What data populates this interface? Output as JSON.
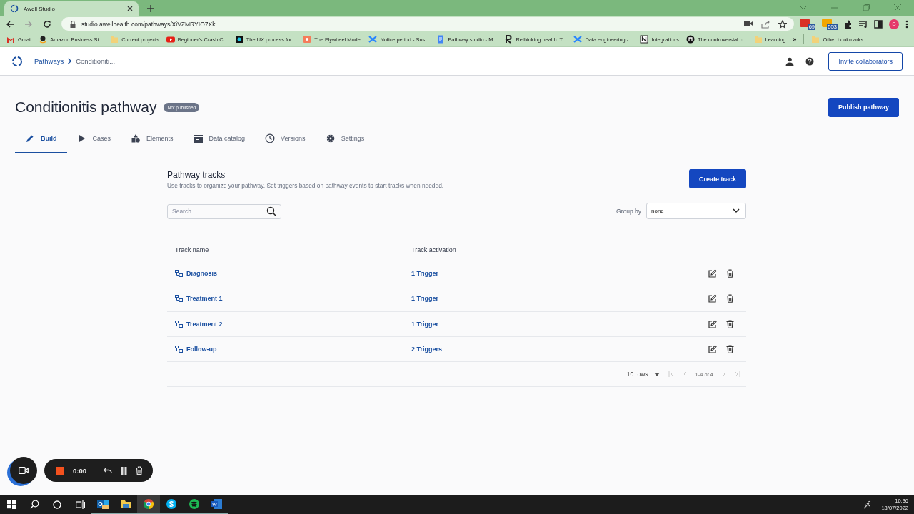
{
  "browser": {
    "tab_title": "Awell Studio",
    "url": "studio.awellhealth.com/pathways/XiVZMRYIO7Xk",
    "extensions": [
      {
        "badge": "69",
        "color": "#d93025"
      },
      {
        "badge": "553",
        "color": "#f2a600"
      }
    ],
    "profile_initial": "S",
    "bookmarks": [
      {
        "label": "Gmail",
        "kind": "gmail"
      },
      {
        "label": "Amazon Business Si...",
        "kind": "amazon"
      },
      {
        "label": "Current projects",
        "kind": "folder"
      },
      {
        "label": "Beginner's Crash C...",
        "kind": "youtube"
      },
      {
        "label": "The UX process for...",
        "kind": "dark"
      },
      {
        "label": "The Flywheel Model",
        "kind": "hubspot"
      },
      {
        "label": "Notice period - Sus...",
        "kind": "confluence"
      },
      {
        "label": "Pathway studio - M...",
        "kind": "docs"
      },
      {
        "label": "Rethinking health: T...",
        "kind": "r"
      },
      {
        "label": "Data engineering -...",
        "kind": "confluence"
      },
      {
        "label": "Integrations",
        "kind": "notion"
      },
      {
        "label": "The controversial c...",
        "kind": "circle"
      },
      {
        "label": "Learning",
        "kind": "folder"
      }
    ],
    "more": "»",
    "other_bookmarks": "Other bookmarks"
  },
  "app": {
    "breadcrumb": [
      {
        "label": "Pathways",
        "link": true
      },
      {
        "label": "Conditioniti...",
        "link": false
      }
    ],
    "invite_button": "Invite collaborators",
    "title": "Conditionitis pathway",
    "status_badge": "Not published",
    "publish_button": "Publish pathway",
    "tabs": [
      {
        "label": "Build",
        "kind": "pencil",
        "selected": true
      },
      {
        "label": "Cases",
        "kind": "play",
        "selected": false
      },
      {
        "label": "Elements",
        "kind": "shapes",
        "selected": false
      },
      {
        "label": "Data catalog",
        "kind": "catalog",
        "selected": false
      },
      {
        "label": "Versions",
        "kind": "clock",
        "selected": false
      },
      {
        "label": "Settings",
        "kind": "gear",
        "selected": false
      }
    ]
  },
  "tracks": {
    "title": "Pathway tracks",
    "description": "Use tracks to organize your pathway. Set triggers based on pathway events to start tracks when needed.",
    "create_button": "Create track",
    "search": {
      "placeholder": "Search"
    },
    "group_by": {
      "label": "Group by",
      "value": "none"
    },
    "table": {
      "columns": [
        "Track name",
        "Track activation"
      ],
      "rows": [
        {
          "name": "Diagnosis",
          "activation": "1 Trigger"
        },
        {
          "name": "Treatment 1",
          "activation": "1 Trigger"
        },
        {
          "name": "Treatment 2",
          "activation": "1 Trigger"
        },
        {
          "name": "Follow-up",
          "activation": "2 Triggers"
        }
      ]
    },
    "pagination": {
      "rows_per_page": "10 rows",
      "range": "1-4 of 4"
    }
  },
  "recorder": {
    "time": "0:00"
  },
  "taskbar": {
    "apps": [
      {
        "kind": "outlook",
        "selected": false
      },
      {
        "kind": "explorer",
        "selected": false
      },
      {
        "kind": "chrome",
        "selected": true
      },
      {
        "kind": "skype",
        "selected": false
      },
      {
        "kind": "spotify",
        "selected": false
      },
      {
        "kind": "word",
        "selected": false
      }
    ],
    "time": "10:36",
    "date": "18/07/2022"
  }
}
